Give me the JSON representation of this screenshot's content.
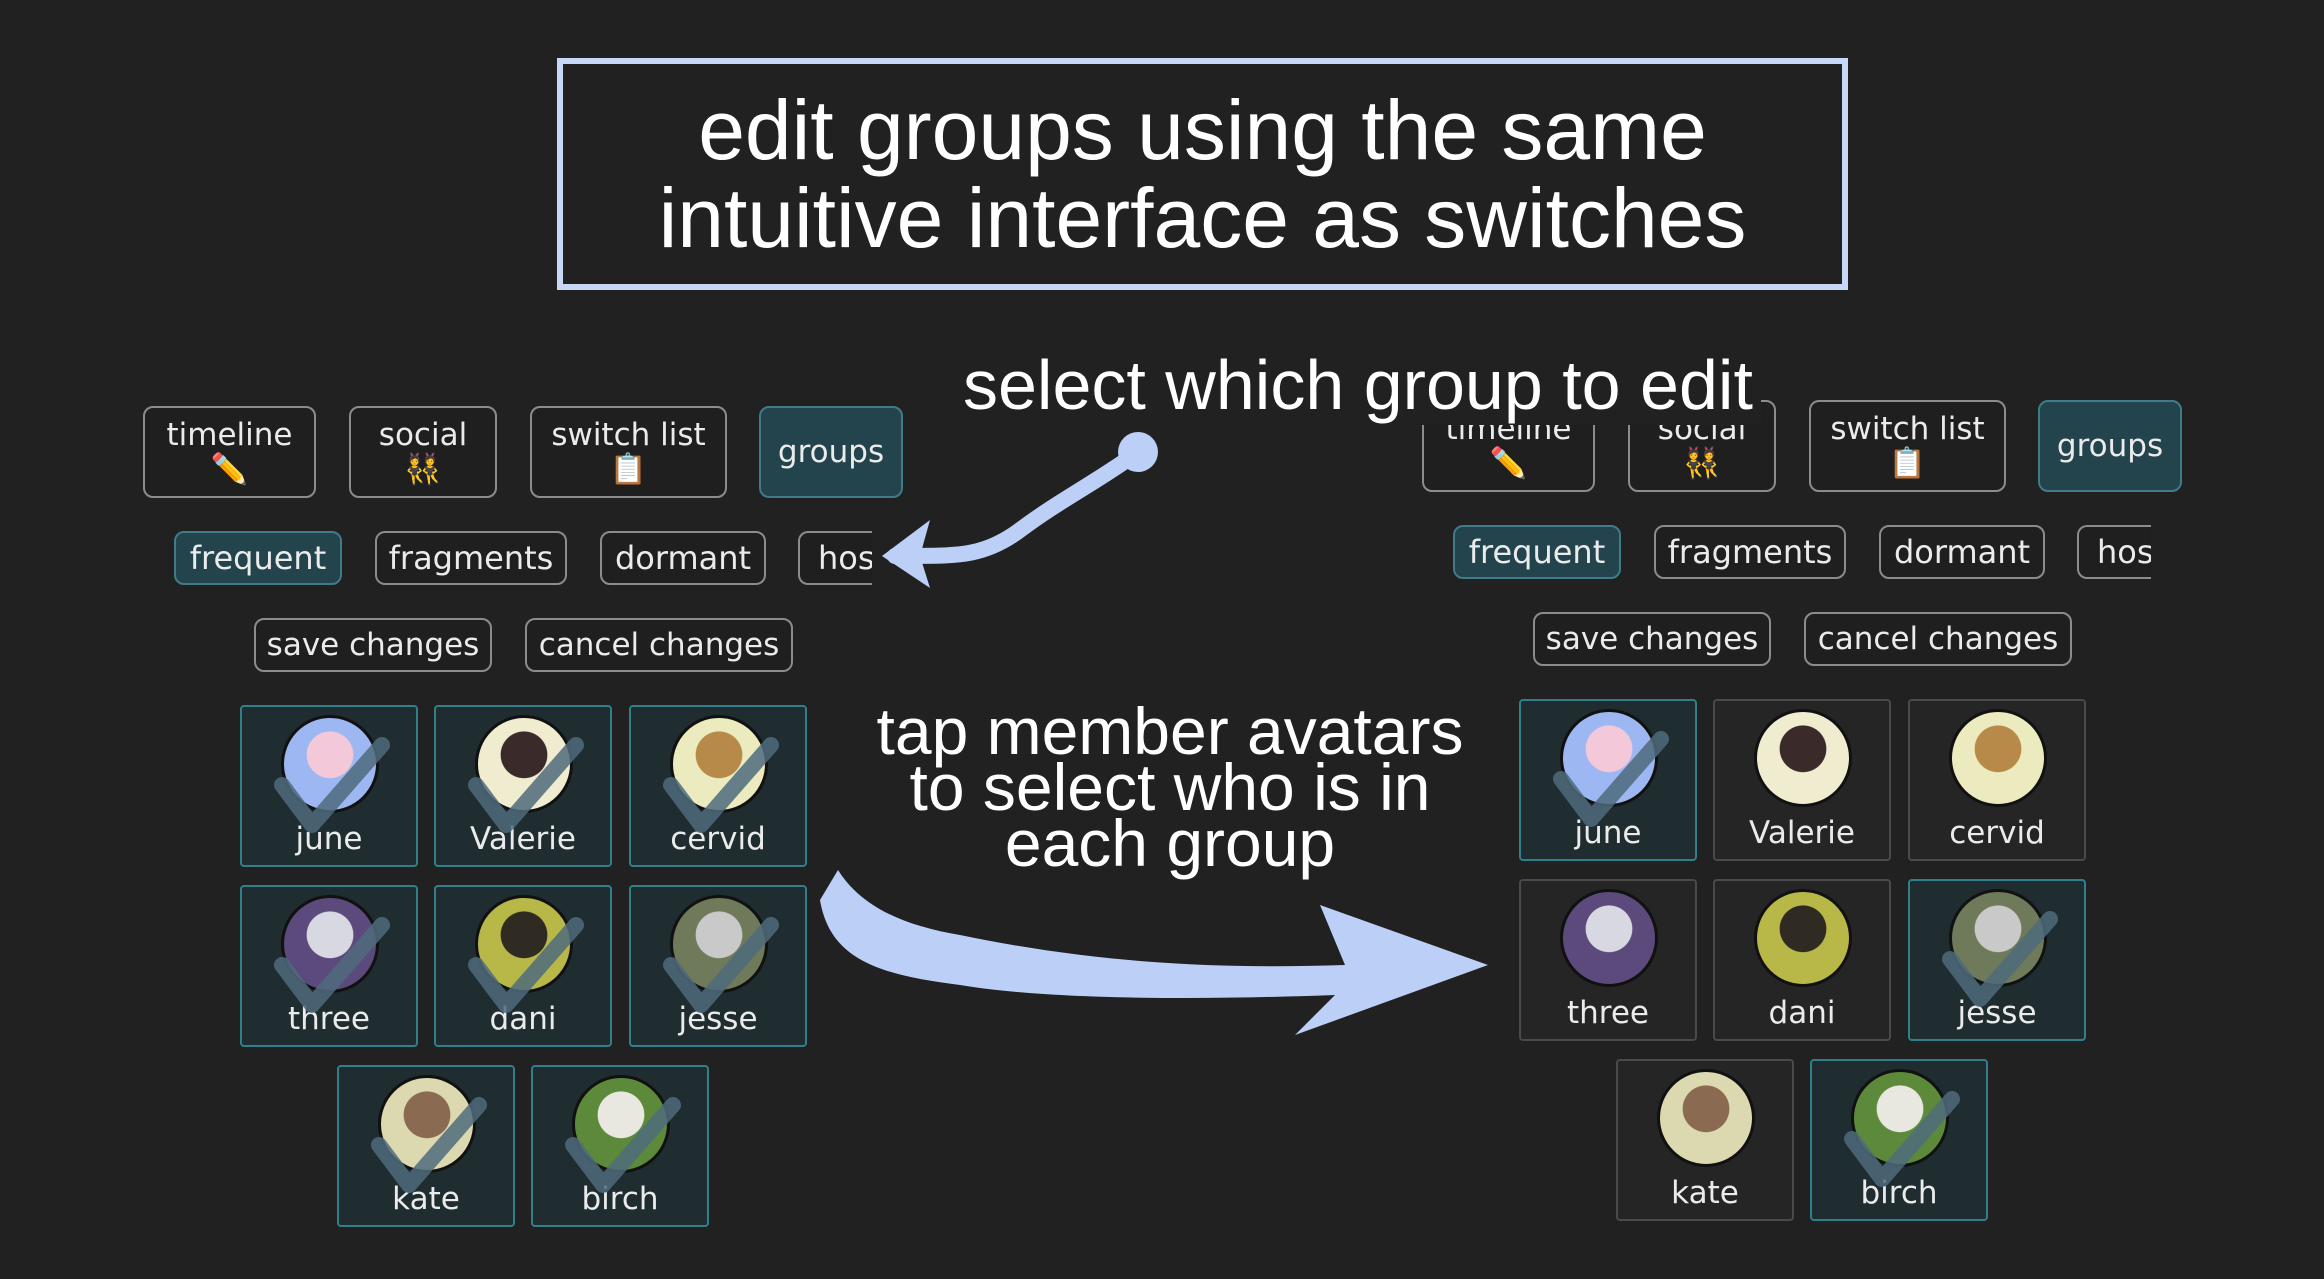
{
  "title": {
    "line1": "edit groups using the same",
    "line2": "intuitive interface as switches"
  },
  "callouts": {
    "select_group": "select which group to edit",
    "tap_line1": "tap member avatars",
    "tap_line2": "to select who is in",
    "tap_line3": "each group"
  },
  "nav": {
    "timeline": {
      "label": "timeline",
      "emoji": "✏️"
    },
    "social": {
      "label": "social",
      "emoji": "👯"
    },
    "switch_list": {
      "label": "switch list",
      "emoji": "📋"
    },
    "groups": {
      "label": "groups"
    }
  },
  "groups": {
    "frequent": "frequent",
    "fragments": "fragments",
    "dormant": "dormant",
    "partial": "hos"
  },
  "actions": {
    "save": "save changes",
    "cancel": "cancel changes"
  },
  "members": [
    "june",
    "Valerie",
    "cervid",
    "three",
    "dani",
    "jesse",
    "kate",
    "birch"
  ],
  "left_selected": [
    true,
    true,
    true,
    true,
    true,
    true,
    true,
    true
  ],
  "right_selected": [
    true,
    false,
    false,
    false,
    false,
    true,
    false,
    true
  ],
  "colors": {
    "background": "#212121",
    "title_border": "#c7d7f7",
    "arrow": "#bcd0f7",
    "active_chip": "#23444c",
    "checkmark": "#4f6b7c"
  }
}
